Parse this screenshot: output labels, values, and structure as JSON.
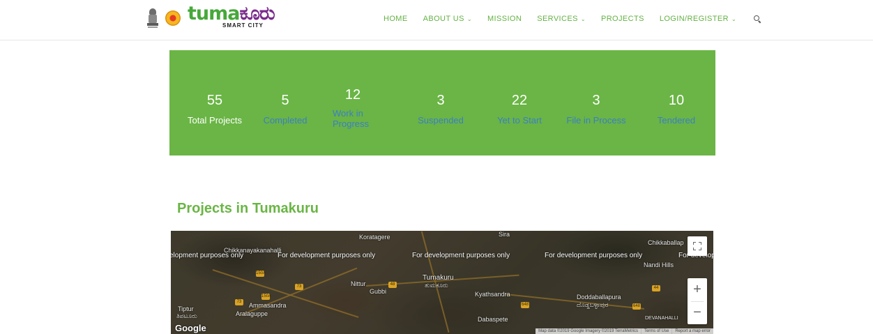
{
  "header": {
    "brand_word_a": "tuma",
    "brand_word_b": "ಕೂರು",
    "brand_sub": "SMART CITY",
    "nav": [
      {
        "label": "HOME",
        "dropdown": false
      },
      {
        "label": "ABOUT US",
        "dropdown": true
      },
      {
        "label": "MISSION",
        "dropdown": false
      },
      {
        "label": "SERVICES",
        "dropdown": true
      },
      {
        "label": "PROJECTS",
        "dropdown": false
      },
      {
        "label": "LOGIN/REGISTER",
        "dropdown": true
      }
    ],
    "chevron": "⌄",
    "search_icon": "search-icon"
  },
  "stats": [
    {
      "value": "55",
      "label": "Total Projects"
    },
    {
      "value": "5",
      "label": "Completed"
    },
    {
      "value": "12",
      "label": "Work in Progress"
    },
    {
      "value": "3",
      "label": "Suspended"
    },
    {
      "value": "22",
      "label": "Yet to Start"
    },
    {
      "value": "3",
      "label": "File in Process"
    },
    {
      "value": "10",
      "label": "Tendered"
    }
  ],
  "section_title": "Projects in Tumakuru",
  "map": {
    "dev_notes": [
      "elopment purposes only",
      "For development purposes only",
      "For development purposes only",
      "For development purposes only",
      "For develop"
    ],
    "places": {
      "chikkanayakanahalli": "Chikkanayakanahalli",
      "tumakuru": "Tumakuru",
      "tumakuru_kn": "ತುಮಕೂರು",
      "nittur": "Nittur",
      "gubbi": "Gubbi",
      "tiptur": "Tiptur",
      "tiptur_kn": "ತಿಪಟೂರು",
      "ammasandra": "Ammasandra",
      "aralaguppe": "Aralaguppe",
      "kyathsandra": "Kyathsandra",
      "doddaballapura": "Doddaballapura",
      "doddaballapura_kn": "ದೊಡ್ಡಬಳ್ಳಾಪುರ",
      "chikkaballapur": "Chikkaballap",
      "nandi_hills": "Nandi Hills",
      "dabaspete": "Dabaspete",
      "devanahalli": "DEVANAHALLI",
      "koratagere": "Koratagere",
      "sira": "Sira"
    },
    "shields": [
      "150A",
      "73",
      "150A",
      "73",
      "48",
      "648",
      "648",
      "44"
    ],
    "google": "Google",
    "attribution": [
      "Map data ©2019 Google Imagery ©2019 TerraMetrics",
      "Terms of Use",
      "Report a map error"
    ],
    "zoom_in": "+",
    "zoom_out": "−"
  }
}
